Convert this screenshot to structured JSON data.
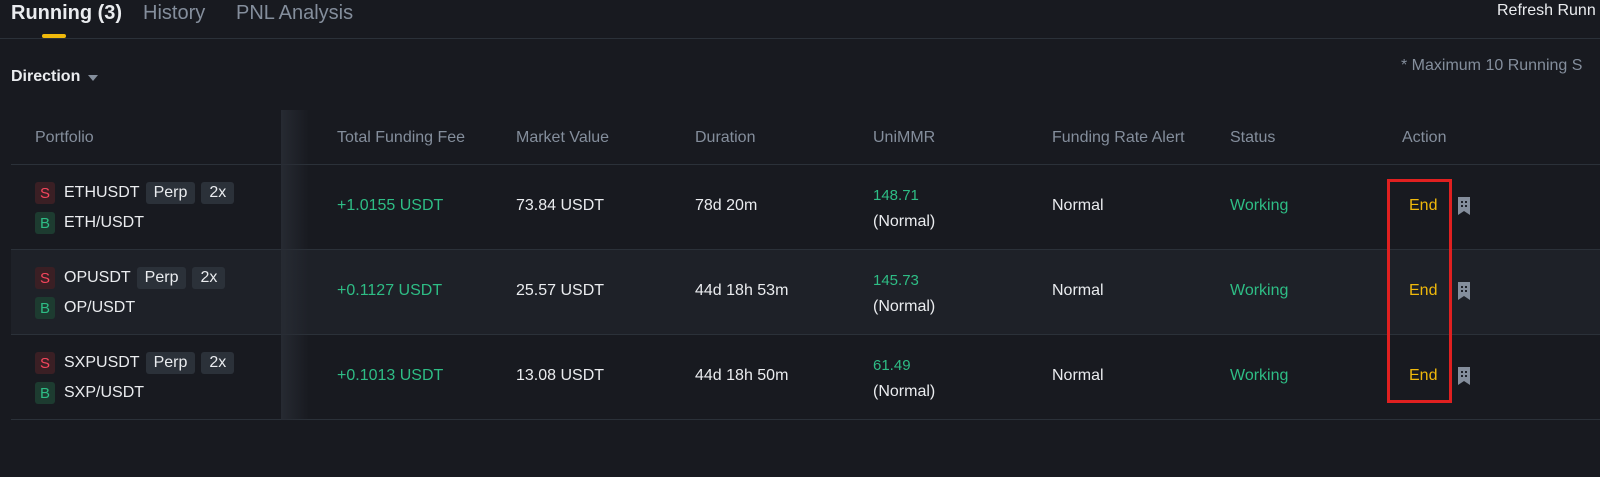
{
  "tabs": [
    {
      "label": "Running (3)",
      "active": true
    },
    {
      "label": "History",
      "active": false
    },
    {
      "label": "PNL Analysis",
      "active": false
    }
  ],
  "refresh_label": "Refresh Runn",
  "filter": {
    "label": "Direction"
  },
  "note": "* Maximum 10 Running S",
  "columns": [
    "Portfolio",
    "Total Funding Fee",
    "Market Value",
    "Duration",
    "UniMMR",
    "Funding Rate Alert",
    "Status",
    "Action"
  ],
  "rows": [
    {
      "sell_side": "S",
      "sell_symbol": "ETHUSDT",
      "type": "Perp",
      "leverage": "2x",
      "buy_side": "B",
      "buy_symbol": "ETH/USDT",
      "funding_fee": "+1.0155 USDT",
      "market_value": "73.84 USDT",
      "duration": "78d 20m",
      "unimmr": "148.71",
      "unimmr_status": "(Normal)",
      "alert": "Normal",
      "status": "Working",
      "action": "End"
    },
    {
      "sell_side": "S",
      "sell_symbol": "OPUSDT",
      "type": "Perp",
      "leverage": "2x",
      "buy_side": "B",
      "buy_symbol": "OP/USDT",
      "funding_fee": "+0.1127 USDT",
      "market_value": "25.57 USDT",
      "duration": "44d 18h 53m",
      "unimmr": "145.73",
      "unimmr_status": "(Normal)",
      "alert": "Normal",
      "status": "Working",
      "action": "End"
    },
    {
      "sell_side": "S",
      "sell_symbol": "SXPUSDT",
      "type": "Perp",
      "leverage": "2x",
      "buy_side": "B",
      "buy_symbol": "SXP/USDT",
      "funding_fee": "+0.1013 USDT",
      "market_value": "13.08 USDT",
      "duration": "44d 18h 50m",
      "unimmr": "61.49",
      "unimmr_status": "(Normal)",
      "alert": "Normal",
      "status": "Working",
      "action": "End"
    }
  ],
  "icons": {
    "row_action": "document-icon",
    "filter": "caret-down-icon"
  },
  "colors": {
    "accent": "#f0b90b",
    "positive": "#2ebd85",
    "negative": "#f6465d",
    "highlight_box": "#e02020"
  }
}
